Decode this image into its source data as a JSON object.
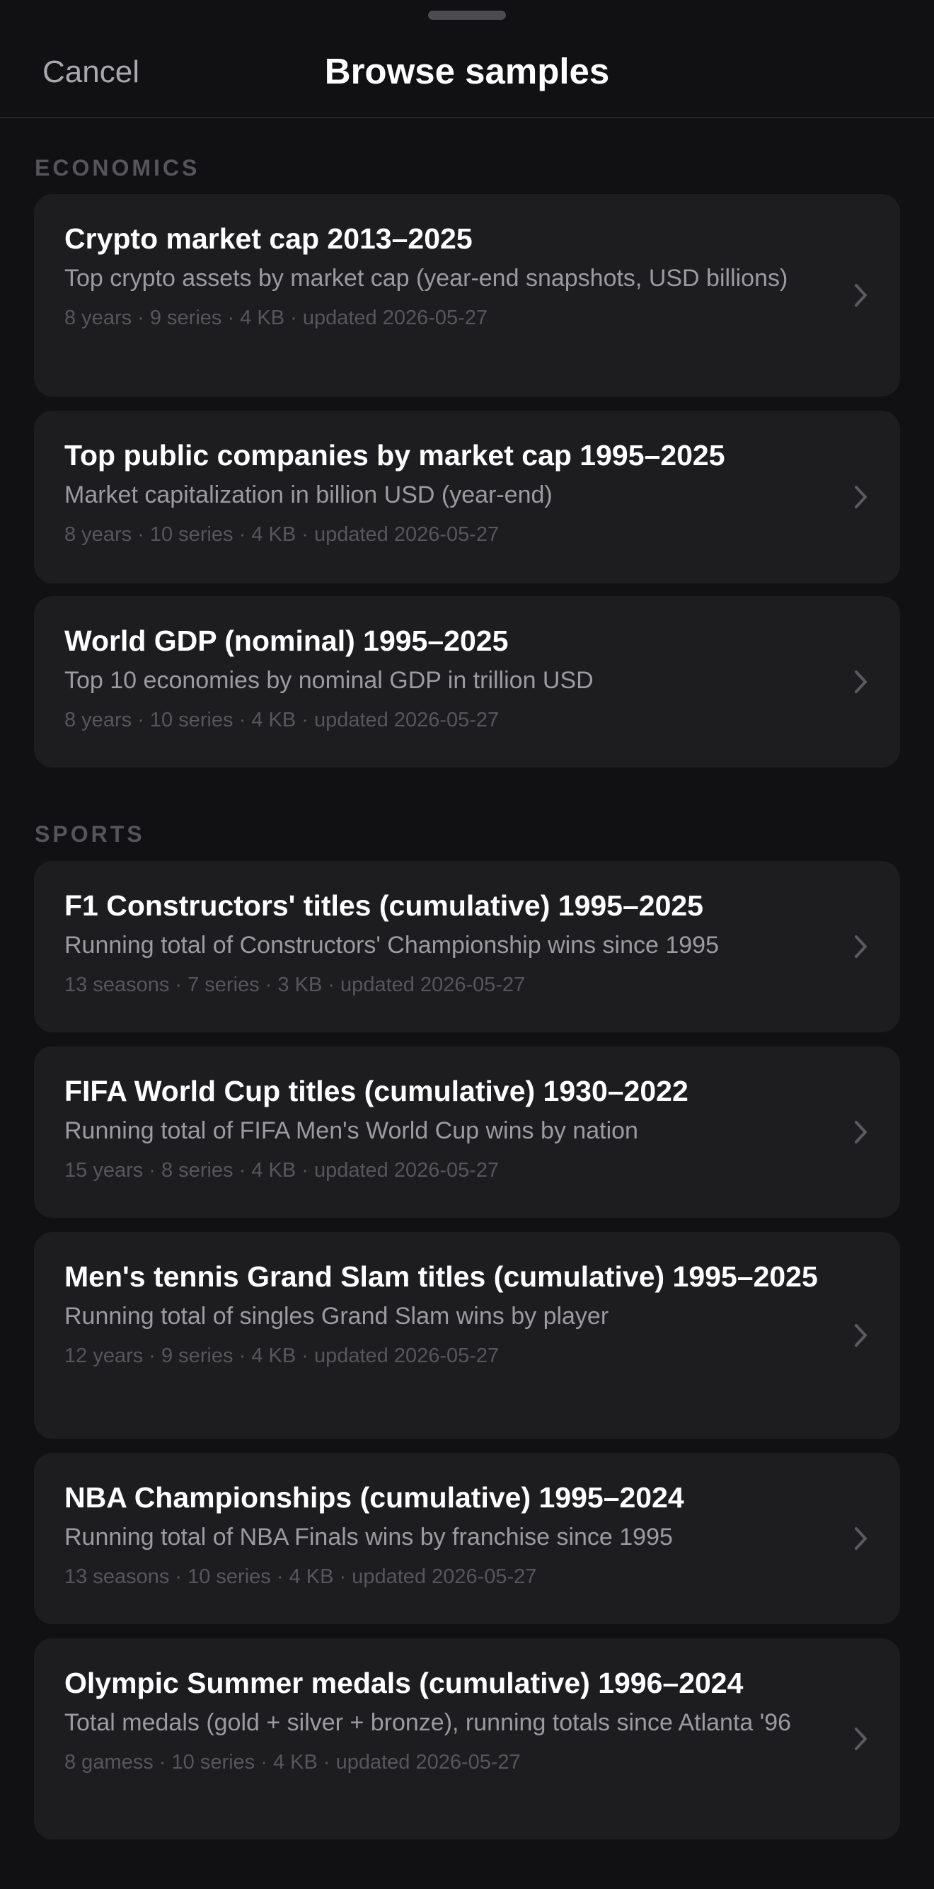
{
  "header": {
    "cancel_label": "Cancel",
    "title": "Browse samples"
  },
  "sections": [
    {
      "label": "ECONOMICS",
      "items": [
        {
          "title": "Crypto market cap 2013–2025",
          "subtitle": "Top crypto assets by market cap (year-end snapshots, USD billions)",
          "meta": "8 years · 9 series · 4 KB · updated 2026-05-27"
        },
        {
          "title": "Top public companies by market cap 1995–2025",
          "subtitle": "Market capitalization in billion USD (year-end)",
          "meta": "8 years · 10 series · 4 KB · updated 2026-05-27"
        },
        {
          "title": "World GDP (nominal) 1995–2025",
          "subtitle": "Top 10 economies by nominal GDP in trillion USD",
          "meta": "8 years · 10 series · 4 KB · updated 2026-05-27"
        }
      ]
    },
    {
      "label": "SPORTS",
      "items": [
        {
          "title": "F1 Constructors' titles (cumulative) 1995–2025",
          "subtitle": "Running total of Constructors' Championship wins since 1995",
          "meta": "13 seasons · 7 series · 3 KB · updated 2026-05-27"
        },
        {
          "title": "FIFA World Cup titles (cumulative) 1930–2022",
          "subtitle": "Running total of FIFA Men's World Cup wins by nation",
          "meta": "15 years · 8 series · 4 KB · updated 2026-05-27"
        },
        {
          "title": "Men's tennis Grand Slam titles (cumulative) 1995–2025",
          "subtitle": "Running total of singles Grand Slam wins by player",
          "meta": "12 years · 9 series · 4 KB · updated 2026-05-27"
        },
        {
          "title": "NBA Championships (cumulative) 1995–2024",
          "subtitle": "Running total of NBA Finals wins by franchise since 1995",
          "meta": "13 seasons · 10 series · 4 KB · updated 2026-05-27"
        },
        {
          "title": "Olympic Summer medals (cumulative) 1996–2024",
          "subtitle": "Total medals (gold + silver + bronze), running totals since Atlanta '96",
          "meta": "8 gamess · 10 series · 4 KB · updated 2026-05-27"
        }
      ]
    }
  ],
  "icons": {
    "chevron": "chevron-right-icon",
    "grabber": "sheet-grabber"
  },
  "colors": {
    "background": "#111113",
    "card": "#1d1d20",
    "title": "#ffffff",
    "subtitle": "#9b9ba0",
    "meta": "#56565b",
    "section_header": "#55555a"
  }
}
